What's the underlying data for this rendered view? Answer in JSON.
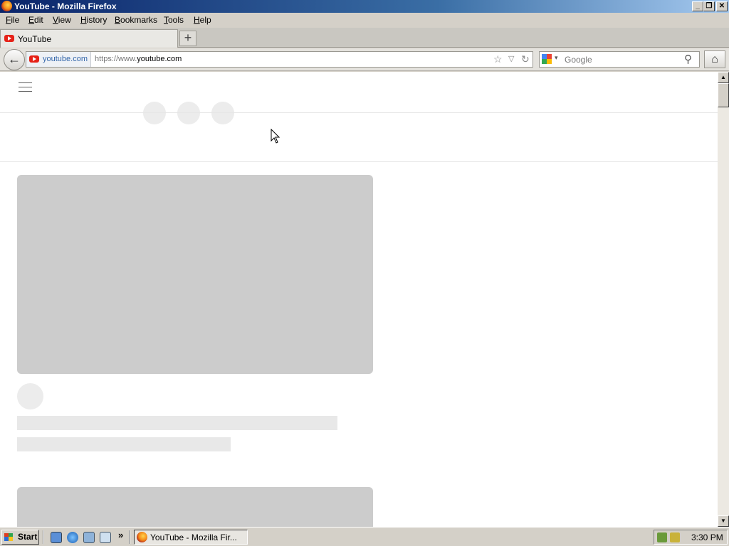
{
  "window": {
    "title": "YouTube - Mozilla Firefox",
    "controls": {
      "minimize": "_",
      "maximize": "❐",
      "close": "✕"
    }
  },
  "menu": {
    "items": [
      {
        "label": "File",
        "accel": "F",
        "rest": "ile"
      },
      {
        "label": "Edit",
        "accel": "E",
        "rest": "dit"
      },
      {
        "label": "View",
        "accel": "V",
        "rest": "iew"
      },
      {
        "label": "History",
        "accel": "H",
        "rest": "istory"
      },
      {
        "label": "Bookmarks",
        "accel": "B",
        "rest": "ookmarks"
      },
      {
        "label": "Tools",
        "accel": "T",
        "rest": "ools"
      },
      {
        "label": "Help",
        "accel": "H",
        "rest": "elp"
      }
    ]
  },
  "tabs": [
    {
      "label": "YouTube",
      "icon": "youtube-icon"
    }
  ],
  "newtab_label": "+",
  "navbar": {
    "back_glyph": "←",
    "identity_label": "youtube.com",
    "url_prefix": "https://www.",
    "url_domain": "youtube.com",
    "search_placeholder": "Google",
    "home_glyph": "⌂",
    "star_glyph": "☆",
    "dropdown_glyph": "▽",
    "reload_glyph": "↻",
    "search_glyph": "⚲",
    "search_dd_glyph": "▾"
  },
  "scrollbar": {
    "up": "▲",
    "down": "▼"
  },
  "taskbar": {
    "start_label": "Start",
    "chevron": "»",
    "task_label": "YouTube - Mozilla Fir...",
    "clock": "3:30 PM"
  },
  "colors": {
    "titlebar_start": "#0a246a",
    "titlebar_end": "#a6caf0",
    "youtube_red": "#e62117",
    "skeleton": "#cccccc",
    "skeleton_light": "#e8e8e8"
  }
}
